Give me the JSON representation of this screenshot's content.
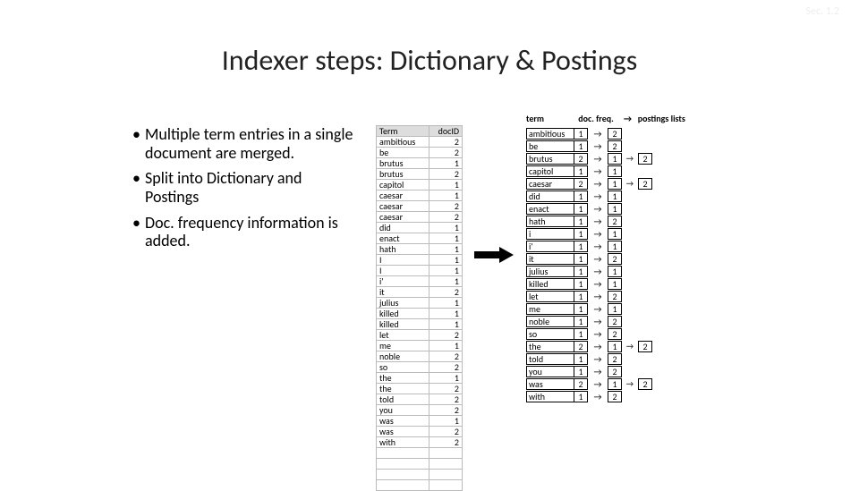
{
  "section": "Sec. 1.2",
  "title": "Indexer steps: Dictionary & Postings",
  "bullets": [
    "Multiple term entries in a single document are merged.",
    "Split into Dictionary and Postings",
    "Doc. frequency information is added."
  ],
  "term_table": {
    "headers": [
      "Term",
      "docID"
    ],
    "rows": [
      [
        "ambitious",
        "2"
      ],
      [
        "be",
        "2"
      ],
      [
        "brutus",
        "1"
      ],
      [
        "brutus",
        "2"
      ],
      [
        "capitol",
        "1"
      ],
      [
        "caesar",
        "1"
      ],
      [
        "caesar",
        "2"
      ],
      [
        "caesar",
        "2"
      ],
      [
        "did",
        "1"
      ],
      [
        "enact",
        "1"
      ],
      [
        "hath",
        "1"
      ],
      [
        "I",
        "1"
      ],
      [
        "I",
        "1"
      ],
      [
        "i'",
        "1"
      ],
      [
        "it",
        "2"
      ],
      [
        "julius",
        "1"
      ],
      [
        "killed",
        "1"
      ],
      [
        "killed",
        "1"
      ],
      [
        "let",
        "2"
      ],
      [
        "me",
        "1"
      ],
      [
        "noble",
        "2"
      ],
      [
        "so",
        "2"
      ],
      [
        "the",
        "1"
      ],
      [
        "the",
        "2"
      ],
      [
        "told",
        "2"
      ],
      [
        "you",
        "2"
      ],
      [
        "was",
        "1"
      ],
      [
        "was",
        "2"
      ],
      [
        "with",
        "2"
      ]
    ],
    "blank_rows": 4
  },
  "dict_headers": {
    "term": "term",
    "df": "doc. freq.",
    "arrow": "→",
    "post": "postings lists"
  },
  "dictionary": [
    {
      "term": "ambitious",
      "df": "1",
      "postings": [
        "2"
      ]
    },
    {
      "term": "be",
      "df": "1",
      "postings": [
        "2"
      ]
    },
    {
      "term": "brutus",
      "df": "2",
      "postings": [
        "1",
        "2"
      ]
    },
    {
      "term": "capitol",
      "df": "1",
      "postings": [
        "1"
      ]
    },
    {
      "term": "caesar",
      "df": "2",
      "postings": [
        "1",
        "2"
      ]
    },
    {
      "term": "did",
      "df": "1",
      "postings": [
        "1"
      ]
    },
    {
      "term": "enact",
      "df": "1",
      "postings": [
        "1"
      ]
    },
    {
      "term": "hath",
      "df": "1",
      "postings": [
        "2"
      ]
    },
    {
      "term": "i",
      "df": "1",
      "postings": [
        "1"
      ]
    },
    {
      "term": "i'",
      "df": "1",
      "postings": [
        "1"
      ]
    },
    {
      "term": "it",
      "df": "1",
      "postings": [
        "2"
      ]
    },
    {
      "term": "julius",
      "df": "1",
      "postings": [
        "1"
      ]
    },
    {
      "term": "killed",
      "df": "1",
      "postings": [
        "1"
      ]
    },
    {
      "term": "let",
      "df": "1",
      "postings": [
        "2"
      ]
    },
    {
      "term": "me",
      "df": "1",
      "postings": [
        "1"
      ]
    },
    {
      "term": "noble",
      "df": "1",
      "postings": [
        "2"
      ]
    },
    {
      "term": "so",
      "df": "1",
      "postings": [
        "2"
      ]
    },
    {
      "term": "the",
      "df": "2",
      "postings": [
        "1",
        "2"
      ]
    },
    {
      "term": "told",
      "df": "1",
      "postings": [
        "2"
      ]
    },
    {
      "term": "you",
      "df": "1",
      "postings": [
        "2"
      ]
    },
    {
      "term": "was",
      "df": "2",
      "postings": [
        "1",
        "2"
      ]
    },
    {
      "term": "with",
      "df": "1",
      "postings": [
        "2"
      ]
    }
  ]
}
